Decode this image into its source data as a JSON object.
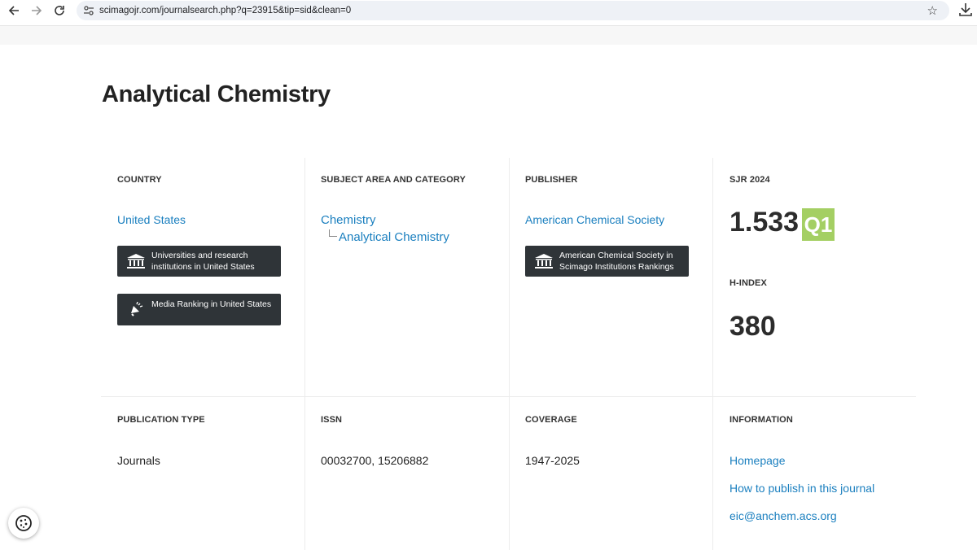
{
  "browser": {
    "url": "scimagojr.com/journalsearch.php?q=23915&tip=sid&clean=0"
  },
  "journal": {
    "title": "Analytical Chemistry"
  },
  "country": {
    "label": "COUNTRY",
    "value": "United States",
    "buttons": [
      "Universities and research institutions in United States",
      "Media Ranking in United States"
    ]
  },
  "subject": {
    "label": "SUBJECT AREA AND CATEGORY",
    "area": "Chemistry",
    "category": "Analytical Chemistry"
  },
  "publisher": {
    "label": "PUBLISHER",
    "value": "American Chemical Society",
    "button": "American Chemical Society in Scimago Institutions Rankings"
  },
  "sjr": {
    "label": "SJR 2024",
    "value": "1.533",
    "quartile": "Q1",
    "quartile_color": "#a4cf63"
  },
  "hindex": {
    "label": "H-INDEX",
    "value": "380"
  },
  "publication_type": {
    "label": "PUBLICATION TYPE",
    "value": "Journals"
  },
  "issn": {
    "label": "ISSN",
    "value": "00032700, 15206882"
  },
  "coverage": {
    "label": "COVERAGE",
    "value": "1947-2025"
  },
  "information": {
    "label": "INFORMATION",
    "links": [
      "Homepage",
      "How to publish in this journal",
      "eic@anchem.acs.org"
    ]
  },
  "colors": {
    "link": "#1a7fbf",
    "dark_button": "#2f3438"
  }
}
